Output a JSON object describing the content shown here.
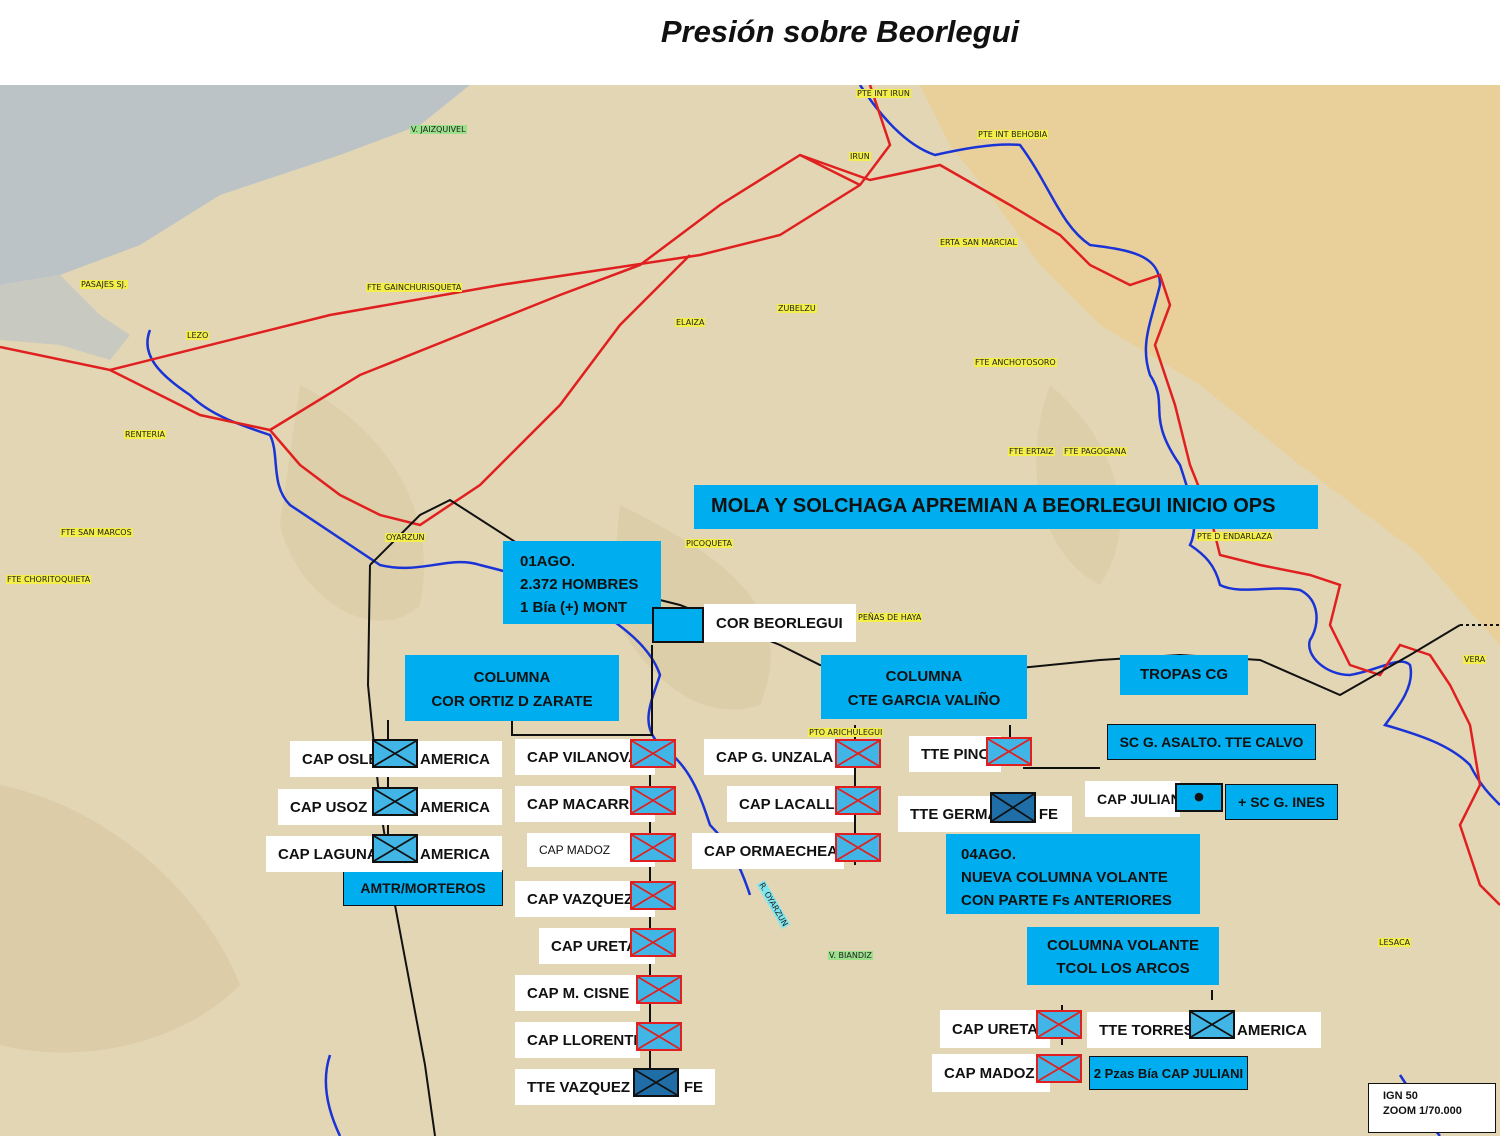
{
  "title": "Presión sobre Beorlegui",
  "places": {
    "pte_int_irun": "PTE INT IRUN",
    "pte_int_behobia": "PTE INT BEHOBIA",
    "irun": "IRUN",
    "v_jaizquivel": "V. JAIZQUIVEL",
    "erta_san_marcial": "ERTA SAN MARCIAL",
    "pasajes": "PASAJES SJ.",
    "lezo": "LEZO",
    "fte_gainchurisqueta": "FTE GAINCHURISQUETA",
    "elaiza": "ELAIZA",
    "zubelzu": "ZUBELZU",
    "fte_anchotosoro": "FTE ANCHOTOSORO",
    "renteria": "RENTERIA",
    "fte_ertaiz": "FTE ERTAIZ",
    "fte_pagogana": "FTE PAGOGANA",
    "fte_san_marcos": "FTE SAN MARCOS",
    "oyarzun": "OYARZUN",
    "picoqueta": "PICOQUETA",
    "pte_endarlaza": "PTE D ENDARLAZA",
    "fte_choritoquieta": "FTE CHORITOQUIETA",
    "penas_de_haya": "PEÑAS DE HAYA",
    "pto_aritxulegui": "PTO ARICHULEGUI",
    "v_biandiz": "V. BIANDIZ",
    "lesaca": "LESACA",
    "vera": "VERA",
    "r_oyarzun": "R. OYARZUN"
  },
  "headline": "MOLA Y SOLCHAGA APREMIAN A BEORLEGUI INICIO OPS",
  "info_01ago": [
    "01AGO.",
    "2.372 HOMBRES",
    "1 Bía (+) MONT"
  ],
  "cor_beorlegui": "COR BEORLEGUI",
  "col_ortiz": [
    "COLUMNA",
    "COR ORTIZ D ZARATE"
  ],
  "col_garcia": [
    "COLUMNA",
    "CTE GARCIA VALIÑO"
  ],
  "tropas_cg": "TROPAS CG",
  "sc_asalto": "SC G. ASALTO. TTE CALVO",
  "sc_ines": "+ SC G. INES",
  "cap_julian": "CAP JULIAN",
  "amtr": "AMTR/MORTEROS",
  "info_04ago": [
    "04AGO.",
    "NUEVA COLUMNA VOLANTE",
    "CON PARTE Fs ANTERIORES"
  ],
  "col_volante": [
    "COLUMNA VOLANTE",
    "TCOL LOS ARCOS"
  ],
  "pzas": "2 Pzas Bía CAP JULIANI",
  "legend": [
    "IGN 50",
    "ZOOM  1/70.000"
  ],
  "units_ortiz_left": [
    {
      "name": "CAP OSLE",
      "suffix": "AMERICA"
    },
    {
      "name": "CAP USOZ",
      "suffix": "AMERICA"
    },
    {
      "name": "CAP LAGUNA",
      "suffix": "AMERICA"
    }
  ],
  "units_ortiz_right": [
    {
      "name": "CAP VILANOVA"
    },
    {
      "name": "CAP MACARRO"
    },
    {
      "name": "CAP MADOZ"
    },
    {
      "name": "CAP VAZQUEZ"
    },
    {
      "name": "CAP URETA"
    },
    {
      "name": "CAP M. CISNE"
    },
    {
      "name": "CAP LLORENTE"
    },
    {
      "name": "TTE VAZQUEZ",
      "suffix": "FE"
    }
  ],
  "units_garcia": [
    {
      "name": "CAP G. UNZALA"
    },
    {
      "name": "CAP LACALLE"
    },
    {
      "name": "CAP ORMAECHEA"
    },
    {
      "name": "TTE PINO"
    },
    {
      "name": "TTE GERMA",
      "suffix": "FE"
    }
  ],
  "units_volante": [
    {
      "name": "CAP URETA"
    },
    {
      "name": "CAP MADOZ"
    },
    {
      "name": "TTE TORRES",
      "suffix": "AMERICA"
    }
  ],
  "colors": {
    "unit_fill": "#41b6e6",
    "box": "#00aeef",
    "front": "#e02020",
    "border_line": "#1a33d6"
  }
}
